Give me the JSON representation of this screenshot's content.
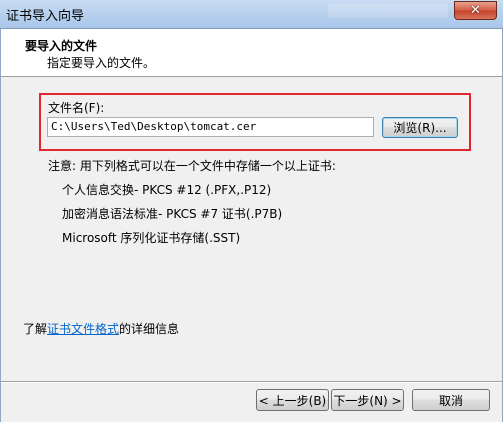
{
  "window": {
    "title": "证书导入向导",
    "close_glyph": "✕"
  },
  "header": {
    "title": "要导入的文件",
    "subtitle": "指定要导入的文件。"
  },
  "file": {
    "label": "文件名(F):",
    "value": "C:\\Users\\Ted\\Desktop\\tomcat.cer",
    "browse_label": "浏览(R)..."
  },
  "note": {
    "intro": "注意: 用下列格式可以在一个文件中存储一个以上证书:",
    "formats": [
      "个人信息交换- PKCS #12 (.PFX,.P12)",
      "加密消息语法标准- PKCS #7 证书(.P7B)",
      "Microsoft 序列化证书存储(.SST)"
    ]
  },
  "learn_more": {
    "prefix": "了解",
    "link": "证书文件格式",
    "suffix": "的详细信息"
  },
  "footer": {
    "back_label": "< 上一步(B)",
    "next_label": "下一步(N) >",
    "cancel_label": "取消"
  },
  "colors": {
    "highlight_box": "#e0262f",
    "link": "#0066cc"
  }
}
